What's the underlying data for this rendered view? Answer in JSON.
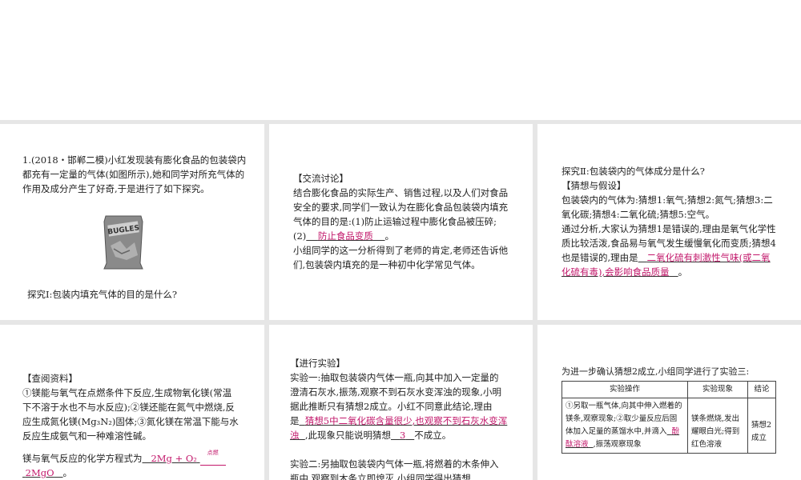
{
  "p1": {
    "intro": "1.(2018・邯郸二模)小红发现装有膨化食品的包装袋内都充有一定量的气体(如图所示),她和同学对所充气体的作用及成分产生了好奇,于是进行了如下探究。",
    "bag_text": "BUGLES",
    "q1": "探究Ⅰ:包装内填充气体的目的是什么?"
  },
  "p2": {
    "heading": "【交流讨论】",
    "body": "结合膨化食品的实际生产、销售过程,以及人们对食品安全的要求,同学们一致认为在膨化食品包装袋内填充气体的目的是:(1)防止运输过程中膨化食品被压碎;(2)",
    "ans1": "防止食品变质",
    "after1": "。",
    "body2": "小组同学的这一分析得到了老师的肯定,老师还告诉他们,包装袋内填充的是一种初中化学常见气体。"
  },
  "p3": {
    "q2": "探究Ⅱ:包装袋内的气体成分是什么?",
    "heading": "【猜想与假设】",
    "hyp": "包装袋内的气体为:猜想1:氧气;猜想2:氮气;猜想3:二氧化碳;猜想4:二氧化硫;猜想5:空气。",
    "analysis": "通过分析,大家认为猜想1是错误的,理由是氧气化学性质比较活泼,食品易与氧气发生缓慢氧化而变质;猜想4也是错误的,理由是",
    "ans": "二氧化硫有刺激性气味(或二氧化硫有毒),会影响食品质量",
    "end": "。"
  },
  "p4": {
    "heading": "【查阅资料】",
    "body": "①镁能与氧气在点燃条件下反应,生成物氧化镁(常温下不溶于水也不与水反应);②镁还能在氮气中燃烧,反应生成氮化镁(Mg₃N₂)固体;③氮化镁在常温下能与水反应生成氨气和一种难溶性碱。",
    "eq_label": "镁与氧气反应的化学方程式为",
    "eq_left": "2Mg + O₂",
    "eq_cond": "点燃",
    "eq_right": "2MgO",
    "eq_end": "。"
  },
  "p5": {
    "heading": "【进行实验】",
    "exp1": "实验一:抽取包装袋内气体一瓶,向其中加入一定量的澄清石灰水,振荡,观察不到石灰水变浑浊的现象,小明据此推断只有猜想2成立。小红不同意此结论,理由是",
    "ans1": "猜想5中二氧化碳含量很少,也观察不到石灰水变浑浊",
    "mid": ",此现象只能说明猜想",
    "ans2": "3",
    "end": "不成立。",
    "exp2": "实验二:另抽取包装袋内气体一瓶,将燃着的木条伸入瓶中,观察到木条立即熄灭,小组同学得出猜想"
  },
  "p6": {
    "intro": "为进一步确认猜想2成立,小组同学进行了实验三:",
    "col_headers": [
      "实验操作",
      "实验现象",
      "结论"
    ],
    "op": "①另取一瓶气体,向其中伸入燃着的镁条,观察现象;②取少量反应后固体加入足量的蒸馏水中,并滴入",
    "op_ans": "酚酞溶液",
    "op_end": ",振荡观察现象",
    "phen": "镁条燃烧,发出耀眼白光;得到红色溶液",
    "concl": "猜想2成立"
  }
}
